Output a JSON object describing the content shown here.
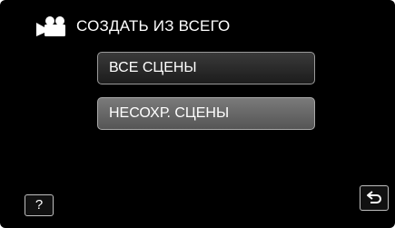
{
  "header": {
    "icon": "video-camera-icon",
    "title": "СОЗДАТЬ ИЗ ВСЕГО"
  },
  "menu": {
    "items": [
      {
        "label": "ВСЕ СЦЕНЫ"
      },
      {
        "label": "НЕСОХР. СЦЕНЫ"
      }
    ]
  },
  "footer": {
    "help_label": "?",
    "back_icon": "return-arrow-icon"
  }
}
